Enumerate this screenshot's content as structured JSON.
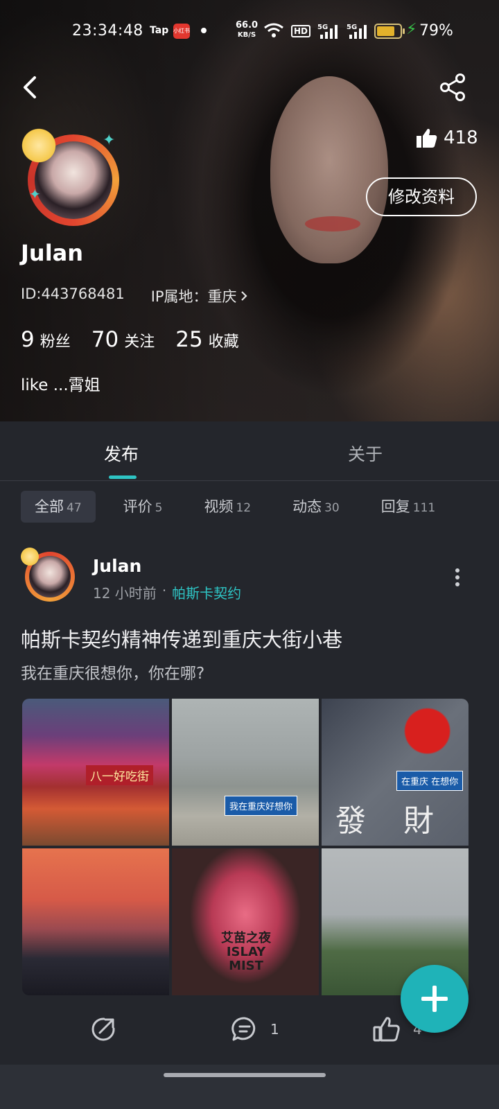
{
  "status_bar": {
    "time": "23:34:48",
    "tap_label": "Tap",
    "app_badge": "小红书",
    "net_speed_value": "66.0",
    "net_speed_unit": "KB/S",
    "hd_label": "HD",
    "signal1_label": "5G",
    "signal2_label": "5G",
    "battery_percent": "79%",
    "battery_level": 0.79
  },
  "profile": {
    "likes": "418",
    "edit_button": "修改资料",
    "username": "Julan",
    "id_text": "ID:443768481",
    "ip_text": "IP属地：重庆",
    "stats": [
      {
        "num": "9",
        "label": "粉丝"
      },
      {
        "num": "70",
        "label": "关注"
      },
      {
        "num": "25",
        "label": "收藏"
      }
    ],
    "bio": "like ...霄姐"
  },
  "tabs": [
    {
      "label": "发布",
      "active": true
    },
    {
      "label": "关于",
      "active": false
    }
  ],
  "filters": [
    {
      "label": "全部",
      "count": "47",
      "active": true
    },
    {
      "label": "评价",
      "count": "5",
      "active": false
    },
    {
      "label": "视频",
      "count": "12",
      "active": false
    },
    {
      "label": "动态",
      "count": "30",
      "active": false
    },
    {
      "label": "回复",
      "count": "111",
      "active": false
    }
  ],
  "post": {
    "username": "Julan",
    "time_ago": "12 小时前",
    "separator": "·",
    "topic": "帕斯卡契约",
    "title": "帕斯卡契约精神传递到重庆大街小巷",
    "text": "我在重庆很想你，你在哪?",
    "images": {
      "img1_text": "八一好吃街",
      "img2_text": "我在重庆好想你",
      "img3_sign": "在重庆 在想你",
      "img3_char1": "發",
      "img3_char2": "財",
      "img5_text": "艾苗之夜 ISLAY MIST"
    },
    "comment_count": "1",
    "like_count": "4"
  },
  "colors": {
    "accent": "#2ec4c4",
    "fab": "#1fb3b8",
    "background": "#24262c"
  },
  "icons": {
    "back": "back-arrow-icon",
    "share": "share-icon",
    "like": "thumbs-up-icon",
    "ip_chevron": "chevron-right-icon",
    "more": "more-vertical-icon",
    "forward": "forward-icon",
    "comment": "comment-icon",
    "fab": "plus-icon"
  }
}
